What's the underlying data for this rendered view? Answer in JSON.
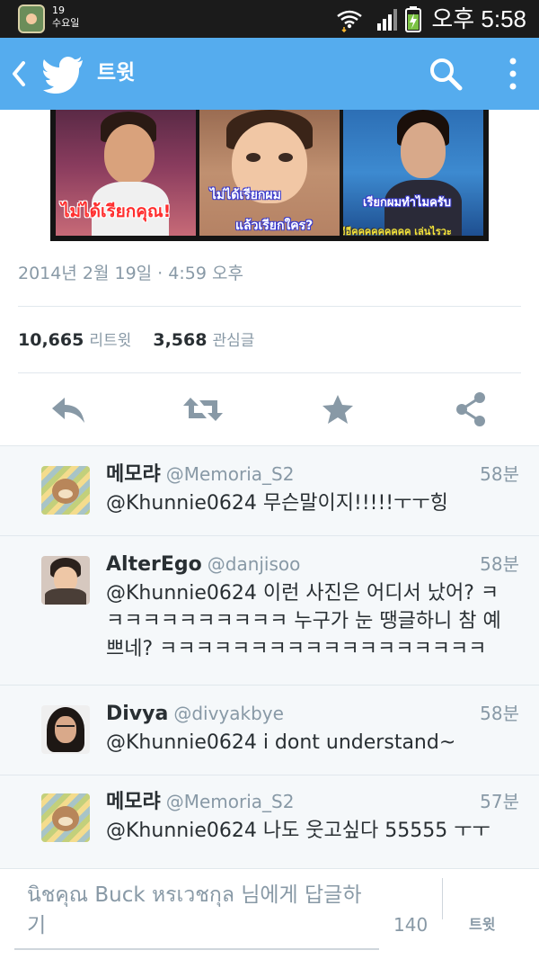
{
  "status_bar": {
    "day_number": "19",
    "weekday": "수요일",
    "time": "오후 5:58"
  },
  "app_bar": {
    "title": "트윗",
    "icons": [
      "back-icon",
      "twitter-bird-icon",
      "search-icon",
      "overflow-menu-icon"
    ]
  },
  "tweet": {
    "image_captions": {
      "panel1": "ไม่ได้เรียกคุณ!",
      "panel2_line1": "ไม่ได้เรียกผม",
      "panel2_line2": "แล้วเรียกใคร?",
      "panel3_line1": "เรียกผมทำไมครับ",
      "panel3_line2": "อีอีคคคคคคคคค เล่นไรวะ"
    },
    "date": "2014년 2월 19일 · 4:59 오후",
    "retweets": {
      "count": "10,665",
      "label": "리트윗"
    },
    "favorites": {
      "count": "3,568",
      "label": "관심글"
    },
    "actions": [
      "reply-icon",
      "retweet-icon",
      "favorite-star-icon",
      "share-icon"
    ]
  },
  "replies": [
    {
      "name": "메모랴",
      "handle": "@Memoria_S2",
      "time": "58분",
      "text": "@Khunnie0624 무슨말이지!!!!!ㅜㅜ힝"
    },
    {
      "name": "AlterEgo",
      "handle": "@danjisoo",
      "time": "58분",
      "text": "@Khunnie0624 이런 사진은 어디서 났어? ㅋㅋㅋㅋㅋㅋㅋㅋㅋㅋㅋ 누구가 눈 땡글하니 참 예쁘네? ㅋㅋㅋㅋㅋㅋㅋㅋㅋㅋㅋㅋㅋㅋㅋㅋㅋㅋ"
    },
    {
      "name": "Divya",
      "handle": "@divyakbye",
      "time": "58분",
      "text": "@Khunnie0624 i dont understand~"
    },
    {
      "name": "메모랴",
      "handle": "@Memoria_S2",
      "time": "57분",
      "text": "@Khunnie0624 나도 웃고싶다 55555 ㅜㅜ"
    }
  ],
  "compose": {
    "placeholder": "นิชคุณ Buck หรเวชกุล 님에게 답글하기",
    "char_count": "140",
    "button_label": "트윗"
  },
  "colors": {
    "brand_blue": "#55acee",
    "status_bar": "#1b1b1b",
    "muted_text": "#8899a6",
    "body_text": "#292f33",
    "replies_bg": "#f5f8fa"
  }
}
